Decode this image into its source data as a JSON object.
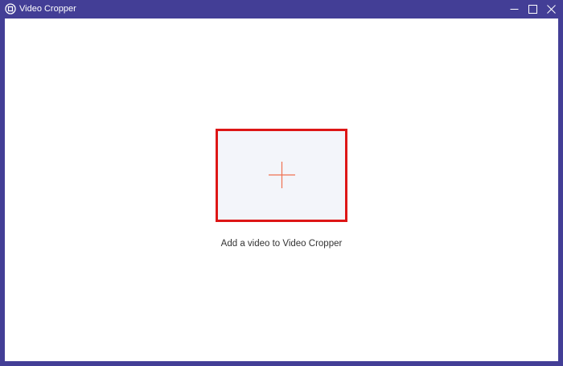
{
  "window": {
    "title": "Video Cropper",
    "app_icon": "video-cropper-icon",
    "controls": {
      "minimize_icon": "minimize-icon",
      "maximize_icon": "maximize-icon",
      "close_icon": "close-icon"
    },
    "colors": {
      "titlebar": "#433e96",
      "background": "#ffffff",
      "drop_zone_fill": "#f3f5fa",
      "drop_zone_border": "#dd1616",
      "plus_color": "#f07050"
    }
  },
  "main": {
    "add_button_icon": "plus-icon",
    "hint": "Add a video to Video Cropper"
  }
}
